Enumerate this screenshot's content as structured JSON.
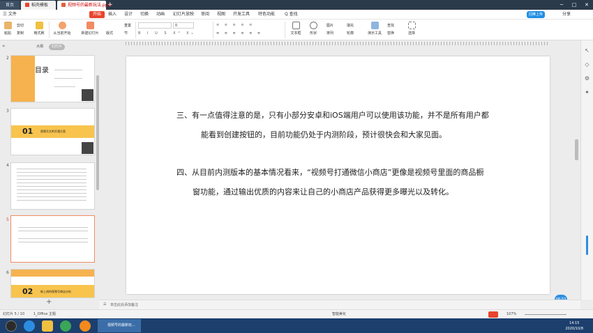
{
  "tabs": {
    "home": "首页",
    "template": "稻壳模板",
    "doc": "视频号的最新玩法.pptx",
    "add": "+"
  },
  "window": {
    "min": "─",
    "max": "□",
    "close": "✕"
  },
  "menu": {
    "file": "三 文件",
    "items": [
      "开始",
      "插入",
      "设计",
      "切换",
      "动画",
      "幻灯片放映",
      "审阅",
      "视图",
      "开发工具",
      "特色功能"
    ],
    "search": "Q 查找",
    "upload": "回推上传",
    "share": "分享"
  },
  "ribbon": {
    "paste": "粘贴",
    "cut": "剪切",
    "copy": "复制",
    "format_painter": "格式刷",
    "from_start": "从当前开始",
    "new_slide": "新建幻灯片",
    "layout": "版式",
    "section": "节",
    "reset": "重置",
    "textbox": "文本框",
    "shape": "形状",
    "arrange": "排列",
    "picture": "图片",
    "fill": "填充",
    "outline": "轮廓",
    "find": "查找",
    "replace": "替换",
    "select": "选择",
    "presenter_tools": "演示工具",
    "font_size": "0"
  },
  "panel": {
    "outline_tab": "大纲",
    "slides_tab": "幻灯片",
    "add": "+"
  },
  "thumbs": [
    {
      "num": "2",
      "title": "目录"
    },
    {
      "num": "3",
      "title": "01",
      "subtitle": "视频号文附开通方案"
    },
    {
      "num": "4"
    },
    {
      "num": "5"
    },
    {
      "num": "6",
      "title": "02",
      "subtitle": "新上线的视频号商店分析"
    }
  ],
  "slide": {
    "p1_line1": "三、有一点值得注意的是，只有小部分安卓和iOS端用户可以使用该功能，并不是所有用户都",
    "p1_line2": "能看到创建按钮的，目前功能仍处于内测阶段，预计很快会和大家见面。",
    "p2_line1": "四、从目前内测版本的基本情况看来，“视频号打通微信小商店”更像是视频号里面的商品橱",
    "p2_line2": "窗功能，通过输出优质的内容来让自己的小商店产品获得更多曝光以及转化。"
  },
  "notes": {
    "placeholder": "单击此处添加备注"
  },
  "status": {
    "slide_info": "幻灯片 5 / 10",
    "theme": "1_Office 主题",
    "smart_beautify": "智能美化",
    "zoom": "107%"
  },
  "taskbar": {
    "app_label": "视频号的最新玩...",
    "time": "14:15",
    "date": "2020/10/8"
  },
  "timer": "06:53",
  "colors": {
    "accent": "#e8442e",
    "tabbar": "#2b3a4a",
    "taskbar": "#1c3f6e",
    "thumb_orange": "#f6b24e"
  }
}
